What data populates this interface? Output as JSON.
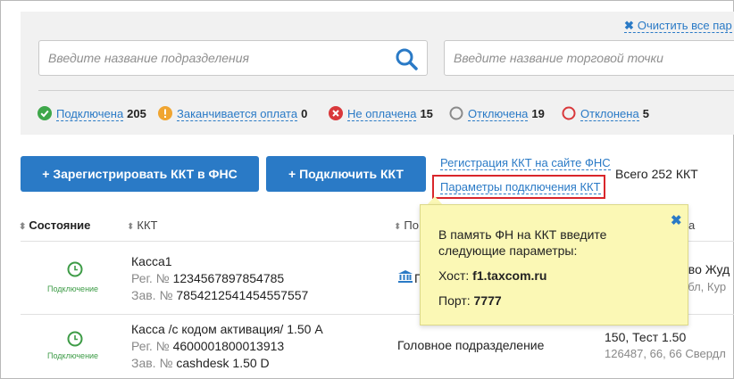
{
  "filters": {
    "clear_all": "Очистить все пар",
    "dept_placeholder": "Введите название подразделения",
    "shop_placeholder": "Введите название торговой точки",
    "stats": [
      {
        "label": "Подключена",
        "count": "205",
        "color": "#3ea74a",
        "icon": "check-circle-icon"
      },
      {
        "label": "Заканчивается оплата",
        "count": "0",
        "color": "#f0a531",
        "icon": "exclamation-circle-icon"
      },
      {
        "label": "Не оплачена",
        "count": "15",
        "color": "#d9383b",
        "icon": "x-circle-icon"
      },
      {
        "label": "Отключена",
        "count": "19",
        "color": "#8a8a8a",
        "icon": "ring-icon"
      },
      {
        "label": "Отклонена",
        "count": "5",
        "color": "#d9383b",
        "icon": "ring-icon"
      }
    ]
  },
  "actions": {
    "register_button": "+ Зарегистрировать ККТ в ФНС",
    "connect_button": "+ Подключить ККТ",
    "register_link": "Регистрация ККТ на сайте ФНС",
    "params_link": "Параметры подключения ККТ",
    "total": "Всего 252 ККТ"
  },
  "table": {
    "headers": {
      "state": "Состояние",
      "kkt": "ККТ",
      "dep": "По",
      "addr": "а"
    },
    "rows": [
      {
        "status": "Подключение",
        "name": "Касса1",
        "reg_label": "Рег. №",
        "reg": "1234567897854785",
        "serial_label": "Зав. №",
        "serial": "7854212541454557557",
        "dep": "Г",
        "addr_main": "ово Жуд",
        "addr_sub": "обл, Кур"
      },
      {
        "status": "Подключение",
        "name": "Касса /с кодом активация/ 1.50 А",
        "reg_label": "Рег. №",
        "reg": "4600001800013913",
        "serial_label": "Зав. №",
        "serial": "cashdesk 1.50 D",
        "dep": "Головное подразделение",
        "addr_main": "150, Тест 1.50",
        "addr_sub": "126487, 66, 66 Свердл"
      }
    ]
  },
  "popup": {
    "intro": "В память ФН на ККТ введите следующие параметры:",
    "host_label": "Хост:",
    "host": "f1.taxcom.ru",
    "port_label": "Порт:",
    "port": "7777"
  },
  "colors": {
    "accent": "#2a7ac6",
    "highlight": "#d9262b",
    "popup_bg": "#fbf8b5",
    "status_green": "#3e9c47"
  }
}
